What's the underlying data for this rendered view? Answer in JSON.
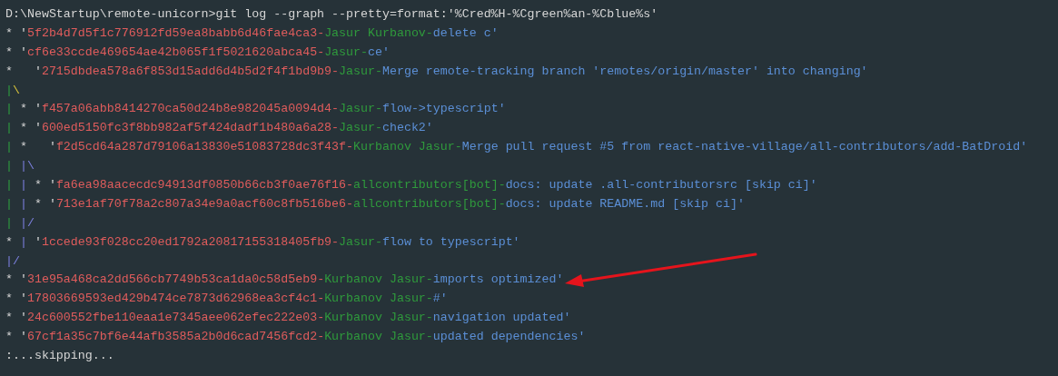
{
  "terminal": {
    "lines": [
      {
        "segments": [
          {
            "kind": "prompt",
            "text": "D:\\NewStartup\\remote-unicorn>git log --graph --pretty=format:'%Cred%H-%Cgreen%an-%Cblue%s'"
          }
        ]
      },
      {
        "segments": [
          {
            "kind": "plain",
            "text": "* '"
          },
          {
            "kind": "hash",
            "text": "5f2b4d7d5f1c776912fd59ea8babb6d46fae4ca3-"
          },
          {
            "kind": "author",
            "text": "Jasur Kurbanov-"
          },
          {
            "kind": "subject",
            "text": "delete c'"
          }
        ]
      },
      {
        "segments": [
          {
            "kind": "plain",
            "text": "* '"
          },
          {
            "kind": "hash",
            "text": "cf6e33ccde469654ae42b065f1f5021620abca45-"
          },
          {
            "kind": "author",
            "text": "Jasur-"
          },
          {
            "kind": "subject",
            "text": "ce'"
          }
        ]
      },
      {
        "segments": [
          {
            "kind": "plain",
            "text": "*   '"
          },
          {
            "kind": "hash",
            "text": "2715dbdea578a6f853d15add6d4b5d2f4f1bd9b9-"
          },
          {
            "kind": "author",
            "text": "Jasur-"
          },
          {
            "kind": "subject",
            "text": "Merge remote-tracking branch 'remotes/origin/master' into changing'"
          }
        ]
      },
      {
        "segments": [
          {
            "kind": "lane1",
            "text": "|"
          },
          {
            "kind": "fork",
            "text": "\\"
          }
        ]
      },
      {
        "segments": [
          {
            "kind": "lane1",
            "text": "|"
          },
          {
            "kind": "plain",
            "text": " * '"
          },
          {
            "kind": "hash",
            "text": "f457a06abb8414270ca50d24b8e982045a0094d4-"
          },
          {
            "kind": "author",
            "text": "Jasur-"
          },
          {
            "kind": "subject",
            "text": "flow->typescript'"
          }
        ]
      },
      {
        "segments": [
          {
            "kind": "lane1",
            "text": "|"
          },
          {
            "kind": "plain",
            "text": " * '"
          },
          {
            "kind": "hash",
            "text": "600ed5150fc3f8bb982af5f424dadf1b480a6a28-"
          },
          {
            "kind": "author",
            "text": "Jasur-"
          },
          {
            "kind": "subject",
            "text": "check2'"
          }
        ]
      },
      {
        "segments": [
          {
            "kind": "lane1",
            "text": "|"
          },
          {
            "kind": "plain",
            "text": " *   '"
          },
          {
            "kind": "hash",
            "text": "f2d5cd64a287d79106a13830e51083728dc3f43f-"
          },
          {
            "kind": "author",
            "text": "Kurbanov Jasur-"
          },
          {
            "kind": "subject",
            "text": "Merge pull request #5 from react-native-village/all-contributors/add-BatDroid'"
          }
        ]
      },
      {
        "segments": [
          {
            "kind": "lane1",
            "text": "| "
          },
          {
            "kind": "lane2",
            "text": "|\\"
          }
        ]
      },
      {
        "segments": [
          {
            "kind": "lane1",
            "text": "| "
          },
          {
            "kind": "lane2",
            "text": "|"
          },
          {
            "kind": "plain",
            "text": " * '"
          },
          {
            "kind": "hash",
            "text": "fa6ea98aacecdc94913df0850b66cb3f0ae76f16-"
          },
          {
            "kind": "author",
            "text": "allcontributors[bot]-"
          },
          {
            "kind": "subject",
            "text": "docs: update .all-contributorsrc [skip ci]'"
          }
        ]
      },
      {
        "segments": [
          {
            "kind": "lane1",
            "text": "| "
          },
          {
            "kind": "lane2",
            "text": "|"
          },
          {
            "kind": "plain",
            "text": " * '"
          },
          {
            "kind": "hash",
            "text": "713e1af70f78a2c807a34e9a0acf60c8fb516be6-"
          },
          {
            "kind": "author",
            "text": "allcontributors[bot]-"
          },
          {
            "kind": "subject",
            "text": "docs: update README.md [skip ci]'"
          }
        ]
      },
      {
        "segments": [
          {
            "kind": "lane1",
            "text": "| "
          },
          {
            "kind": "lane2",
            "text": "|/"
          }
        ]
      },
      {
        "segments": [
          {
            "kind": "plain",
            "text": "* "
          },
          {
            "kind": "lane2",
            "text": "|"
          },
          {
            "kind": "plain",
            "text": " '"
          },
          {
            "kind": "hash",
            "text": "1ccede93f028cc20ed1792a20817155318405fb9-"
          },
          {
            "kind": "author",
            "text": "Jasur-"
          },
          {
            "kind": "subject",
            "text": "flow to typescript'"
          }
        ]
      },
      {
        "segments": [
          {
            "kind": "lane2",
            "text": "|/"
          }
        ]
      },
      {
        "segments": [
          {
            "kind": "plain",
            "text": "* '"
          },
          {
            "kind": "hash",
            "text": "31e95a468ca2dd566cb7749b53ca1da0c58d5eb9-"
          },
          {
            "kind": "author",
            "text": "Kurbanov Jasur-"
          },
          {
            "kind": "subject",
            "text": "imports optimized'"
          }
        ]
      },
      {
        "segments": [
          {
            "kind": "plain",
            "text": "* '"
          },
          {
            "kind": "hash",
            "text": "17803669593ed429b474ce7873d62968ea3cf4c1-"
          },
          {
            "kind": "author",
            "text": "Kurbanov Jasur-"
          },
          {
            "kind": "subject",
            "text": "#'"
          }
        ]
      },
      {
        "segments": [
          {
            "kind": "plain",
            "text": "* '"
          },
          {
            "kind": "hash",
            "text": "24c600552fbe110eaa1e7345aee062efec222e03-"
          },
          {
            "kind": "author",
            "text": "Kurbanov Jasur-"
          },
          {
            "kind": "subject",
            "text": "navigation updated'"
          }
        ]
      },
      {
        "segments": [
          {
            "kind": "plain",
            "text": "* '"
          },
          {
            "kind": "hash",
            "text": "67cf1a35c7bf6e44afb3585a2b0d6cad7456fcd2-"
          },
          {
            "kind": "author",
            "text": "Kurbanov Jasur-"
          },
          {
            "kind": "subject",
            "text": "updated dependencies'"
          }
        ]
      },
      {
        "segments": [
          {
            "kind": "plain",
            "text": ":...skipping..."
          }
        ]
      }
    ]
  }
}
